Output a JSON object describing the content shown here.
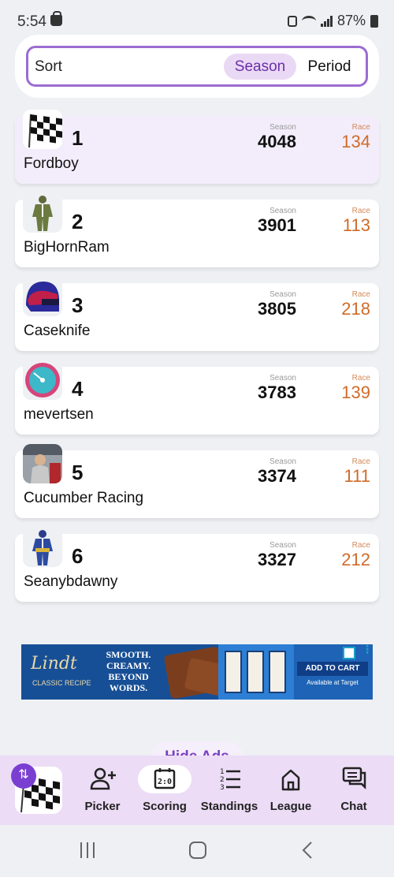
{
  "status_bar": {
    "time": "5:54",
    "battery": "87%"
  },
  "sort": {
    "label": "Sort",
    "options": [
      "Season",
      "Period"
    ],
    "selected": "Season"
  },
  "standings": [
    {
      "rank": "1",
      "team": "Fordboy",
      "season_label": "Season",
      "season": "4048",
      "race_label": "Race",
      "race": "134",
      "avatar": "checkered-flag",
      "highlighted": true
    },
    {
      "rank": "2",
      "team": "BigHornRam",
      "season_label": "Season",
      "season": "3901",
      "race_label": "Race",
      "race": "113",
      "avatar": "green-firesuit",
      "highlighted": false
    },
    {
      "rank": "3",
      "team": "Caseknife",
      "season_label": "Season",
      "season": "3805",
      "race_label": "Race",
      "race": "218",
      "avatar": "helmet",
      "highlighted": false
    },
    {
      "rank": "4",
      "team": "mevertsen",
      "season_label": "Season",
      "season": "3783",
      "race_label": "Race",
      "race": "139",
      "avatar": "pink-gauge",
      "highlighted": false
    },
    {
      "rank": "5",
      "team": "Cucumber Racing",
      "season_label": "Season",
      "season": "3374",
      "race_label": "Race",
      "race": "111",
      "avatar": "driver-photo",
      "highlighted": false
    },
    {
      "rank": "6",
      "team": "Seanybdawny",
      "season_label": "Season",
      "season": "3327",
      "race_label": "Race",
      "race": "212",
      "avatar": "blue-firesuit",
      "highlighted": false
    }
  ],
  "ad": {
    "brand": "Lindt",
    "brand_sub": "CLASSIC RECIPE",
    "copy": "SMOOTH. CREAMY. BEYOND WORDS.",
    "cta": "ADD TO CART",
    "cta_sub": "Available at Target"
  },
  "hide_ads": "Hide Ads",
  "bottom_nav": {
    "items": [
      {
        "label": "Picker",
        "icon": "person-add-icon"
      },
      {
        "label": "Scoring",
        "icon": "scoreboard-icon",
        "active": true
      },
      {
        "label": "Standings",
        "icon": "ranked-list-icon"
      },
      {
        "label": "League",
        "icon": "home-icon"
      },
      {
        "label": "Chat",
        "icon": "chat-icon"
      }
    ]
  },
  "colors": {
    "accent": "#7a3fd1",
    "race": "#cf6b2a",
    "highlight": "#f3edfb",
    "nav_bg": "#ecdcf6"
  }
}
